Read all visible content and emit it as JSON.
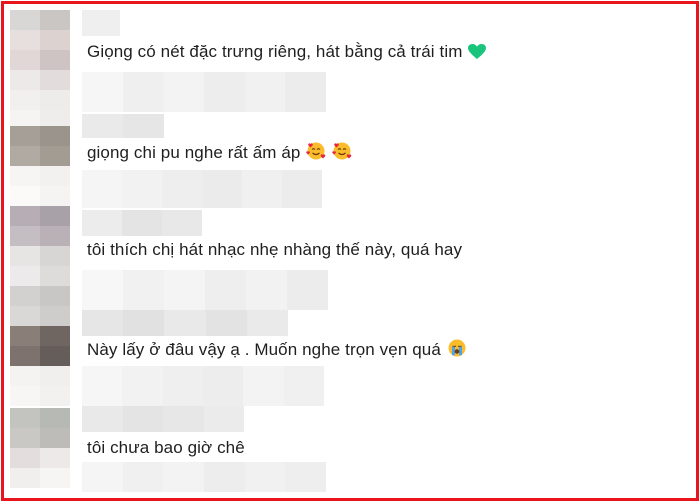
{
  "comments": [
    {
      "text": "Giọng có nét đặc trưng riêng, hát bằng cả trái tim",
      "emoji": "green-heart-icon"
    },
    {
      "text": "giọng chi pu nghe rất ấm áp",
      "emoji": "smiling-face-with-hearts-icon"
    },
    {
      "text": "tôi thích chị hát nhạc nhẹ nhàng thế này, quá hay"
    },
    {
      "text": "Này lấy ở đâu vậy ạ . Muốn nghe trọn vẹn quá",
      "emoji": "crying-face-icon"
    },
    {
      "text": "tôi chưa bao giờ chê"
    }
  ],
  "colors": {
    "frame_border": "#e8151c",
    "text": "#1f1f1f",
    "heart": "#1bc47d"
  }
}
